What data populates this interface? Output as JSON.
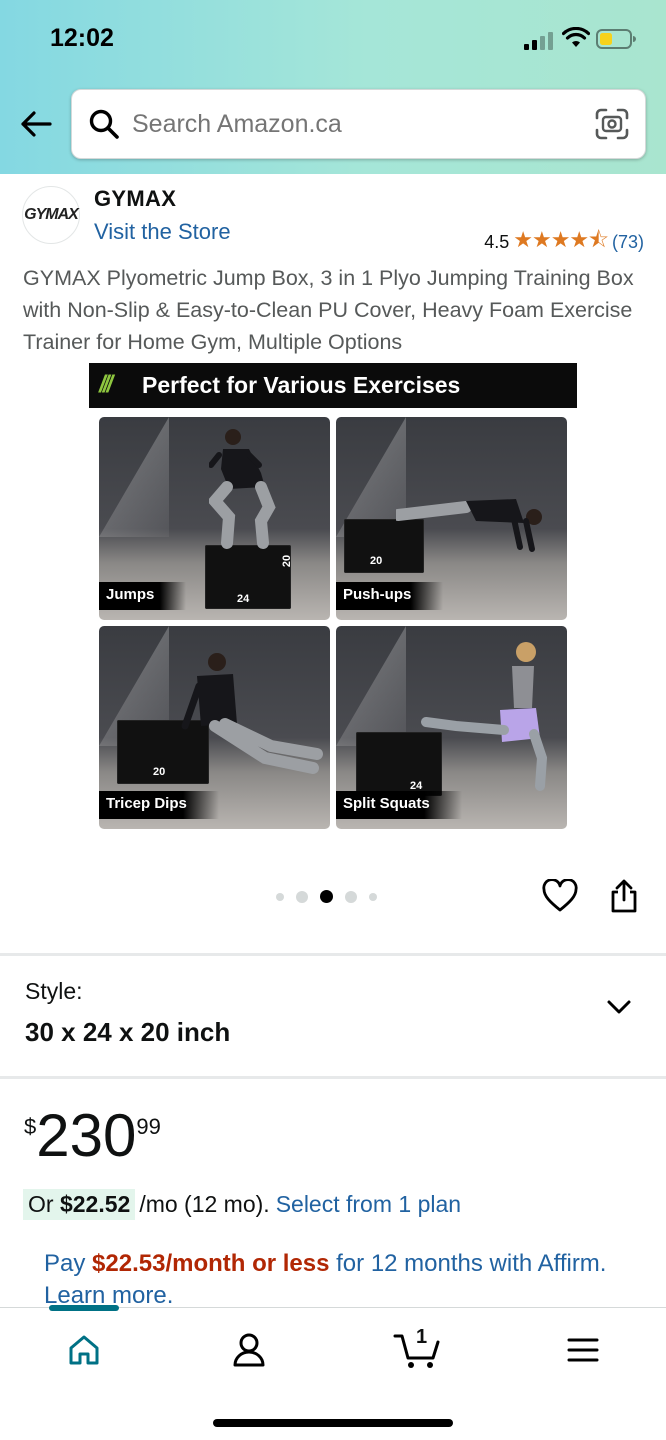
{
  "status_bar": {
    "time": "12:02"
  },
  "search": {
    "placeholder": "Search Amazon.ca"
  },
  "brand": {
    "logo_text": "GYMAX",
    "name": "GYMAX",
    "store_link": "Visit the Store"
  },
  "rating": {
    "value": "4.5",
    "stars": "★★★★⯪",
    "count": "(73)"
  },
  "product_title": "GYMAX Plyometric Jump Box, 3 in 1 Plyo Jumping Training Box with Non-Slip & Easy-to-Clean PU Cover, Heavy Foam Exercise Trainer for Home Gym, Multiple Options",
  "image": {
    "banner_slashes": "///",
    "banner_title": "Perfect for Various Exercises",
    "tiles": [
      {
        "label": "Jumps",
        "box_number": "20",
        "box_number_2": "24"
      },
      {
        "label": "Push-ups",
        "box_number": "20"
      },
      {
        "label": "Tricep Dips",
        "box_number": "20"
      },
      {
        "label": "Split Squats",
        "box_number": "24"
      }
    ],
    "carousel_active_index": 2,
    "carousel_count": 5
  },
  "style": {
    "label": "Style:",
    "value": "30 x 24 x 20 inch"
  },
  "price": {
    "currency": "$",
    "whole": "230",
    "fraction": "99"
  },
  "installment": {
    "prefix": "Or ",
    "amount": "$22.52",
    "term": "/mo (12 mo).",
    "link": "Select from 1 plan"
  },
  "affirm": {
    "pay": "Pay ",
    "highlight": "$22.53/month or less",
    "rest": " for 12 months with Affirm. Learn more."
  },
  "tabbar": {
    "cart_count": "1",
    "active_tab": "home"
  },
  "colors": {
    "link": "#2162a1",
    "price_red": "#b12704",
    "star": "#de7921",
    "tab_active": "#007185",
    "header_start": "#84d8e2",
    "header_end": "#a9e5cf"
  }
}
